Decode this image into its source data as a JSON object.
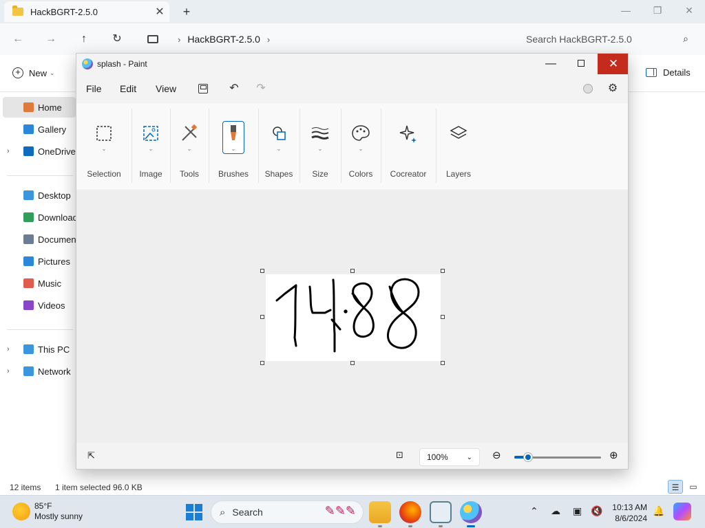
{
  "explorer": {
    "tab_title": "HackBGRT-2.5.0",
    "address": {
      "crumb": "HackBGRT-2.5.0"
    },
    "search_placeholder": "Search HackBGRT-2.5.0",
    "new_label": "New",
    "details_label": "Details",
    "sidebar": [
      {
        "label": "Home",
        "icon": "home-icon",
        "color": "#e07a3c",
        "expandable": false,
        "active": true
      },
      {
        "label": "Gallery",
        "icon": "gallery-icon",
        "color": "#2b88d8",
        "expandable": false
      },
      {
        "label": "OneDrive",
        "icon": "onedrive-icon",
        "color": "#0f6cbd",
        "expandable": true
      },
      {
        "label": "Desktop",
        "icon": "desktop-icon",
        "color": "#3a96dd",
        "expandable": false
      },
      {
        "label": "Downloads",
        "icon": "downloads-icon",
        "color": "#2f9e5b",
        "expandable": false
      },
      {
        "label": "Documents",
        "icon": "documents-icon",
        "color": "#6b7c93",
        "expandable": false
      },
      {
        "label": "Pictures",
        "icon": "pictures-icon",
        "color": "#2b88d8",
        "expandable": false
      },
      {
        "label": "Music",
        "icon": "music-icon",
        "color": "#e25c4b",
        "expandable": false
      },
      {
        "label": "Videos",
        "icon": "videos-icon",
        "color": "#8a44c9",
        "expandable": false
      },
      {
        "label": "This PC",
        "icon": "this-pc-icon",
        "color": "#3a96dd",
        "expandable": true
      },
      {
        "label": "Network",
        "icon": "network-icon",
        "color": "#3a96dd",
        "expandable": true
      }
    ],
    "status": {
      "items": "12 items",
      "selection": "1 item selected  96.0 KB"
    }
  },
  "paint": {
    "title": "splash - Paint",
    "menu": {
      "file": "File",
      "edit": "Edit",
      "view": "View"
    },
    "ribbon": [
      {
        "label": "Selection",
        "icon": "selection-icon"
      },
      {
        "label": "Image",
        "icon": "image-icon"
      },
      {
        "label": "Tools",
        "icon": "tools-icon"
      },
      {
        "label": "Brushes",
        "icon": "brushes-icon"
      },
      {
        "label": "Shapes",
        "icon": "shapes-icon"
      },
      {
        "label": "Size",
        "icon": "size-icon"
      },
      {
        "label": "Colors",
        "icon": "colors-icon"
      },
      {
        "label": "Cocreator",
        "icon": "cocreator-icon"
      },
      {
        "label": "Layers",
        "icon": "layers-icon"
      }
    ],
    "canvas_text": "1488",
    "zoom": "100%",
    "zoom_level_fraction": 0.16,
    "accent": "#0067c0",
    "close_color": "#c42b1c"
  },
  "taskbar": {
    "weather_temp": "85°F",
    "weather_desc": "Mostly sunny",
    "search_label": "Search",
    "time": "10:13 AM",
    "date": "8/6/2024"
  }
}
